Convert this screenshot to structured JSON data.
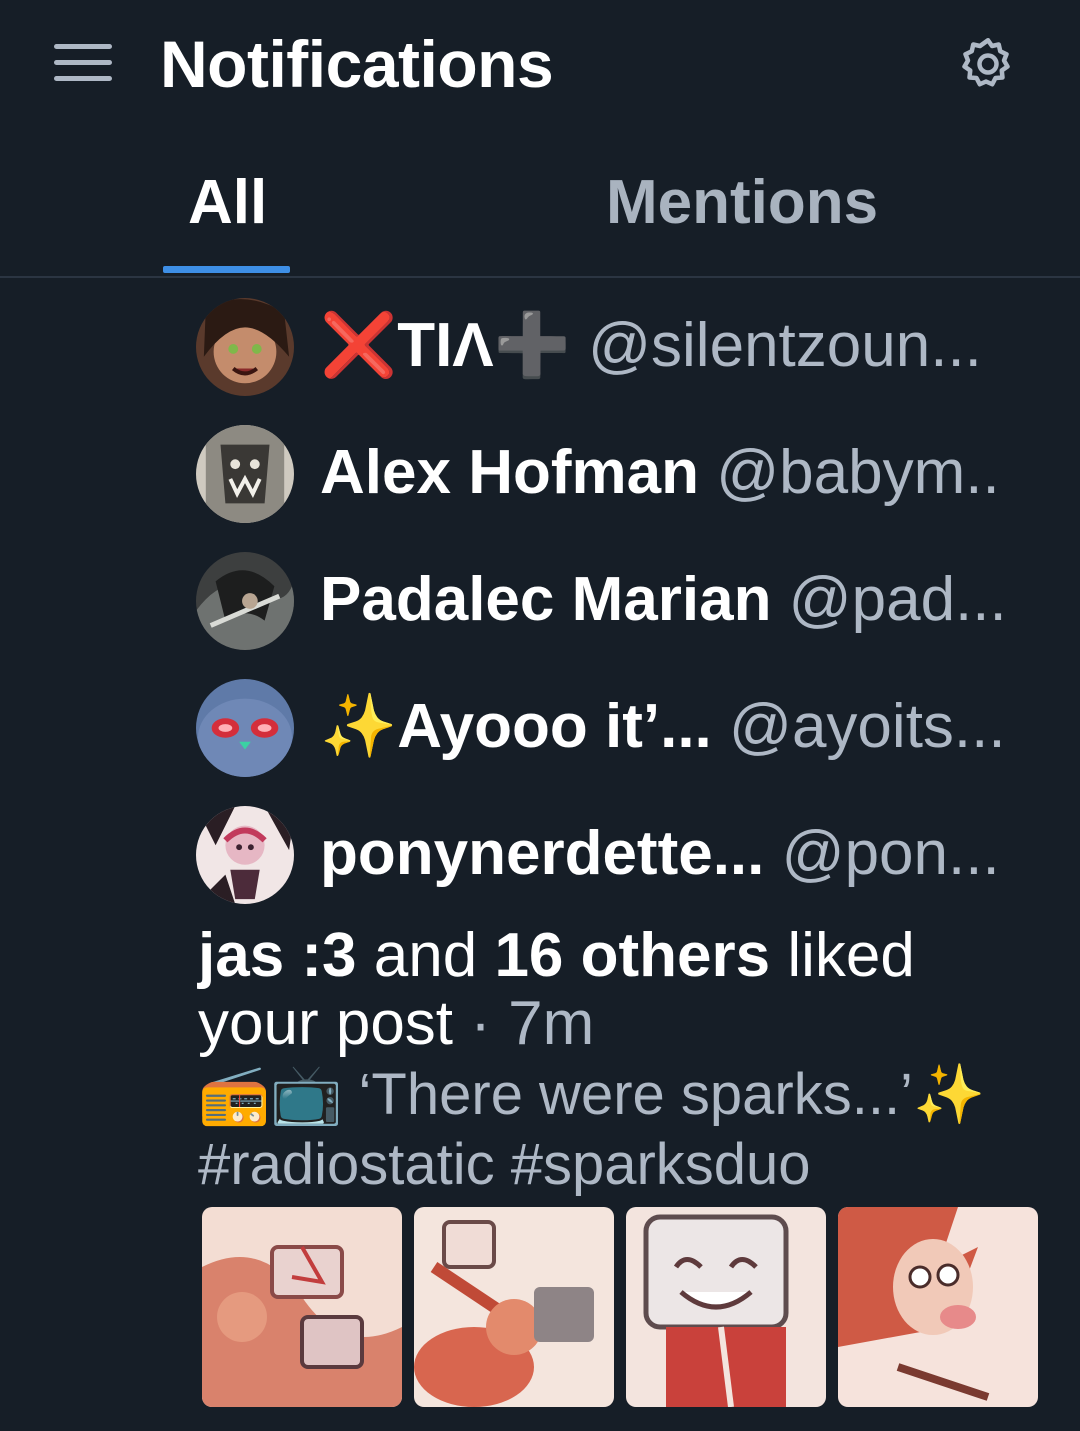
{
  "header": {
    "title": "Notifications",
    "menu_icon": "hamburger-menu-icon",
    "settings_icon": "gear-icon"
  },
  "tabs": [
    {
      "label": "All",
      "active": true
    },
    {
      "label": "Mentions",
      "active": false
    }
  ],
  "likers": [
    {
      "name": "❌TIΛ➕",
      "handle": "@silentzoun..."
    },
    {
      "name": "Alex Hofman",
      "handle": "@babym.."
    },
    {
      "name": "Padalec Marian",
      "handle": "@pad..."
    },
    {
      "name": "✨Ayooo it’...",
      "handle": "@ayoits..."
    },
    {
      "name": "ponynerdette...",
      "handle": "@pon..."
    }
  ],
  "notification": {
    "actor": "jas :3",
    "connector": " and ",
    "others": "16 others",
    "action": " liked your post",
    "separator": " · ",
    "time": "7m"
  },
  "post": {
    "text_line1": "📻📺 ‘There were sparks...’✨",
    "text_line2": "#radiostatic #sparksduo",
    "images": [
      {
        "name": "post-image-1"
      },
      {
        "name": "post-image-2"
      },
      {
        "name": "post-image-3"
      },
      {
        "name": "post-image-4"
      }
    ]
  },
  "colors": {
    "background": "#161e27",
    "accent": "#3e8fe6",
    "muted_text": "#aeb8c5"
  }
}
